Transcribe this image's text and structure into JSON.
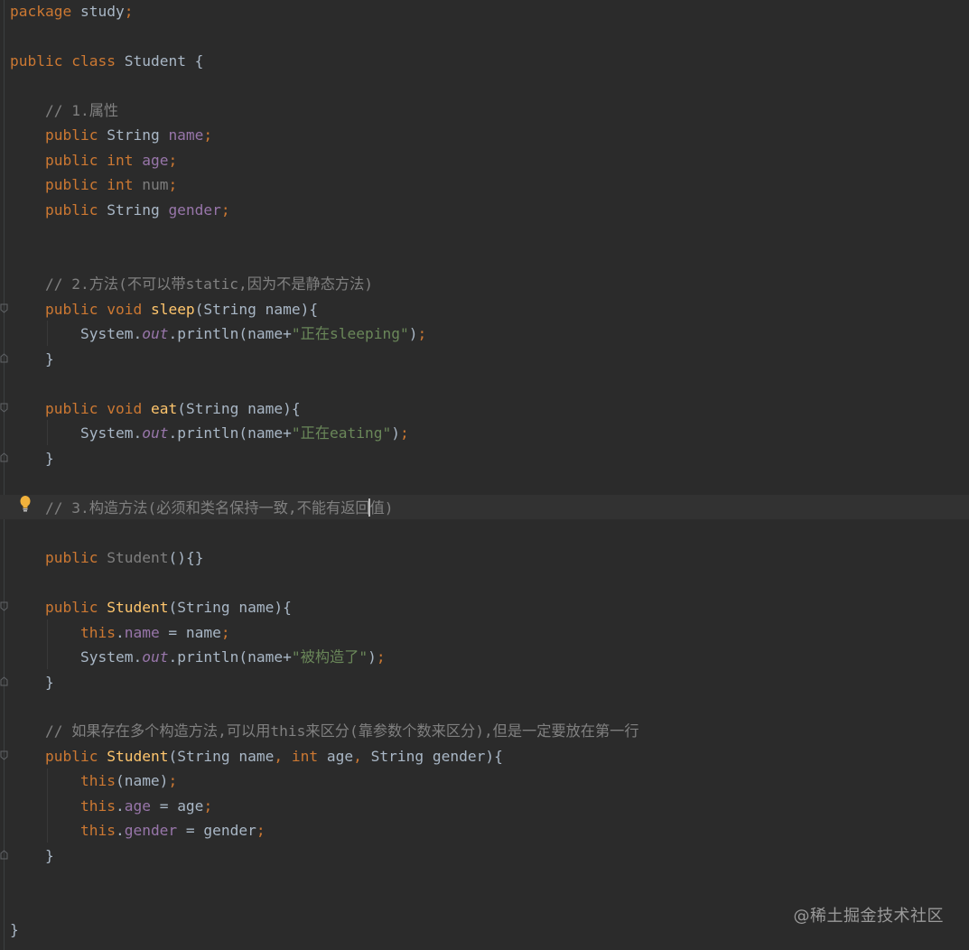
{
  "editor": {
    "code": {
      "l1": {
        "kw": "package",
        "rest": " study",
        "semi": ";"
      },
      "l3": {
        "kw1": "public",
        "kw2": "class",
        "name": " Student {"
      },
      "l5": {
        "comment": "// 1.属性"
      },
      "l6": {
        "kw": "public",
        "type": " String ",
        "field": "name",
        "semi": ";"
      },
      "l7": {
        "kw": "public",
        "type": "int",
        "field": "age",
        "semi": ";"
      },
      "l8": {
        "kw": "public",
        "type": "int",
        "field": "num",
        "semi": ";"
      },
      "l9": {
        "kw": "public",
        "type": " String ",
        "field": "gender",
        "semi": ";"
      },
      "l12": {
        "comment": "// 2.方法(不可以带static,因为不是静态方法)"
      },
      "l13": {
        "kw1": "public",
        "kw2": "void",
        "fn": "sleep",
        "rest": "(String name){"
      },
      "l14": {
        "sys": "System.",
        "out": "out",
        "call": ".println(name+",
        "str": "\"正在sleeping\"",
        "end": ")",
        "semi": ";"
      },
      "l15": {
        "brace": "}"
      },
      "l17": {
        "kw1": "public",
        "kw2": "void",
        "fn": "eat",
        "rest": "(String name){"
      },
      "l18": {
        "sys": "System.",
        "out": "out",
        "call": ".println(name+",
        "str": "\"正在eating\"",
        "end": ")",
        "semi": ";"
      },
      "l19": {
        "brace": "}"
      },
      "l21": {
        "comment_before": "// 3.构造方法(必须和类名保持一致,不能有返回",
        "comment_after": "值)"
      },
      "l23": {
        "kw": "public",
        "fn": "Student",
        "rest": "(){}"
      },
      "l25": {
        "kw": "public",
        "fn": "Student",
        "rest": "(String name){"
      },
      "l26": {
        "kw": "this",
        "dot": ".",
        "field": "name",
        "rest": " = name",
        "semi": ";"
      },
      "l27": {
        "sys": "System.",
        "out": "out",
        "call": ".println(name+",
        "str": "\"被构造了\"",
        "end": ")",
        "semi": ";"
      },
      "l28": {
        "brace": "}"
      },
      "l30": {
        "comment": "// 如果存在多个构造方法,可以用this来区分(靠参数个数来区分),但是一定要放在第一行"
      },
      "l31": {
        "kw": "public",
        "fn": "Student",
        "p1": "(String name",
        "c1": ",",
        "kw2": "int",
        "p2": " age",
        "c2": ",",
        "p3": " String gender){"
      },
      "l32": {
        "kw": "this",
        "rest": "(name)",
        "semi": ";"
      },
      "l33": {
        "kw": "this",
        "dot": ".",
        "field": "age",
        "rest": " = age",
        "semi": ";"
      },
      "l34": {
        "kw": "this",
        "dot": ".",
        "field": "gender",
        "rest": " = gender",
        "semi": ";"
      },
      "l35": {
        "brace": "}"
      },
      "l38": {
        "brace": "}"
      }
    },
    "watermark": "@稀土掘金技术社区",
    "colors": {
      "background": "#2b2b2b",
      "keyword": "#cc7832",
      "field": "#9876aa",
      "string": "#6a8759",
      "comment": "#808080",
      "function": "#ffc66d",
      "text": "#a9b7c6"
    },
    "icons": {
      "bulb": "lightbulb-icon",
      "fold": "fold-marker-icon"
    }
  }
}
